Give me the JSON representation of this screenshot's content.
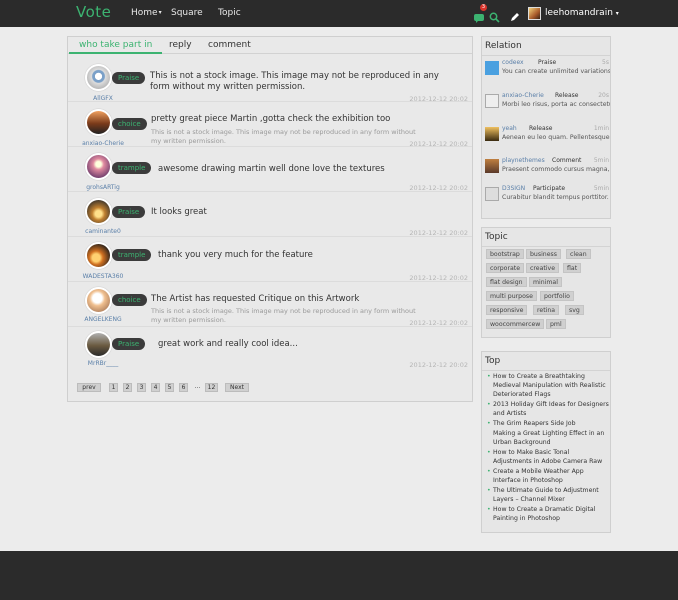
{
  "nav": {
    "brand": "Vote",
    "links": [
      {
        "label": "Home",
        "caret": "▾"
      },
      {
        "label": "Square"
      },
      {
        "label": "Topic"
      }
    ],
    "notification_count": "3",
    "username": "leehomandrain",
    "caret": "▾"
  },
  "tabs": [
    "who take part in",
    "reply",
    "comment"
  ],
  "rows": [
    {
      "user": "AllGFX",
      "badge": "Praise",
      "text": "This is not a stock image. This image may not be reproduced in any form without my written permission.",
      "sub": "",
      "date": "2012-12-12 20:02"
    },
    {
      "user": "anxiao-Cherie",
      "badge": "choice",
      "text": "pretty great piece Martin ,gotta check the exhibition too",
      "sub": "This is not a stock image. This image may not be reproduced in any form without my written permission.",
      "date": "2012-12-12 20:02"
    },
    {
      "user": "grohsARTig",
      "badge": "trample",
      "text": "awesome drawing martin well done love the textures",
      "sub": "",
      "date": "2012-12-12 20:02"
    },
    {
      "user": "caminante0",
      "badge": "Praise",
      "text": "It looks great",
      "sub": "",
      "date": "2012-12-12 20:02"
    },
    {
      "user": "WADESTA360",
      "badge": "trample",
      "text": "thank you very much for the feature",
      "sub": "",
      "date": "2012-12-12 20:02"
    },
    {
      "user": "ANGELKENG",
      "badge": "choice",
      "text": "The Artist has requested Critique on this Artwork",
      "sub": "This is not a stock image. This image may not be reproduced in any form without my written permission.",
      "date": "2012-12-12 20:02"
    },
    {
      "user": "MrRBr____",
      "badge": "Praise",
      "text": "great work and really cool idea...",
      "sub": "",
      "date": "2012-12-12 20:02"
    }
  ],
  "pager": [
    "prev",
    "1",
    "2",
    "3",
    "4",
    "5",
    "6",
    "...",
    "12",
    "Next"
  ],
  "relation": {
    "title": "Relation",
    "items": [
      {
        "name": "codeex",
        "action": "Praise",
        "time": "5s",
        "text": "You can create unlimited variations of elements and colour ..."
      },
      {
        "name": "anxiao-Cherie",
        "action": "Release",
        "time": "20s",
        "text": "Morbi leo risus, porta ac consectetur ac, vestibulum at eros."
      },
      {
        "name": "yeah",
        "action": "Release",
        "time": "1min",
        "text": "Aenean eu leo quam. Pellentesque ornare sem lacinia quam venenatis."
      },
      {
        "name": "playnethemes",
        "action": "Comment",
        "time": "5min",
        "text": "Praesent commodo cursus magna, vel scelerisque nisl consectetur."
      },
      {
        "name": "D3SIGN",
        "action": "Participate",
        "time": "5min",
        "text": "Curabitur blandit tempus porttitor. Nullam id dolor id nibh ultricies..."
      }
    ]
  },
  "topic": {
    "title": "Topic",
    "tags": [
      "bootstrap",
      "business",
      "clean",
      "corporate",
      "creative",
      "flat",
      "flat design",
      "minimal",
      "multi purpose",
      "portfolio",
      "responsive",
      "retina",
      "svg",
      "woocommercew",
      "pml"
    ]
  },
  "top": {
    "title": "Top",
    "items": [
      "How to Create a Breathtaking Medieval Manipulation with Realistic Deteriorated Flags",
      "2013 Holiday Gift Ideas for Designers and Artists",
      "The Grim Reapers Side Job",
      "Making a Great Lighting Effect in an Urban Background",
      "How to Make Basic Tonal Adjustments in Adobe Camera Raw",
      "Create a Mobile Weather App Interface in Photoshop",
      "The Ultimate Guide to Adjustment Layers – Channel Mixer",
      "How to Create a Dramatic Digital Painting in Photoshop"
    ]
  },
  "colors": {
    "accent": "#3cb371",
    "topbar": "#2b2b2b",
    "badge_bg": "#3b3b3b"
  }
}
